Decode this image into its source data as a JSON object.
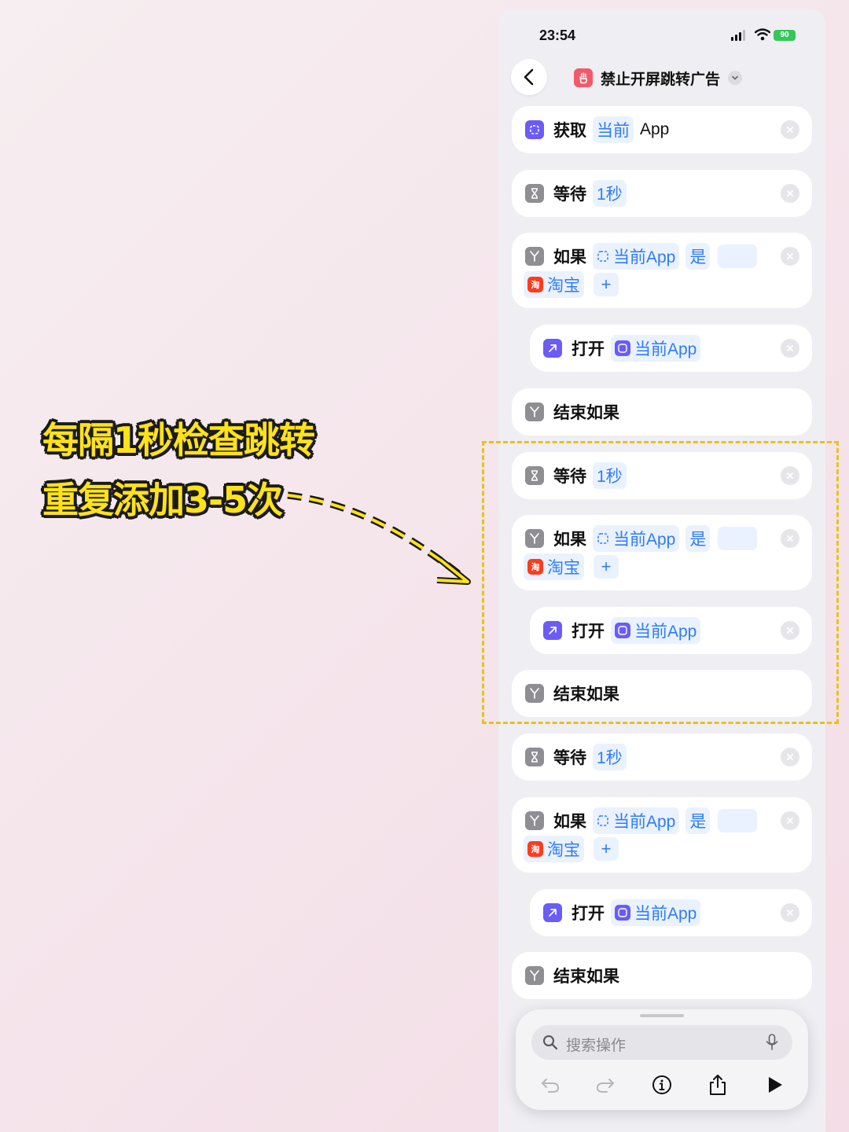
{
  "annotation": {
    "line1": "每隔1秒检查跳转",
    "line2": "重复添加3-5次"
  },
  "status_bar": {
    "time": "23:54",
    "battery": "90"
  },
  "header": {
    "title": "禁止开屏跳转广告"
  },
  "actions": {
    "get_app": {
      "verb": "获取",
      "token": "当前",
      "tail": "App"
    },
    "wait1": {
      "verb": "等待",
      "token": "1秒"
    },
    "if1": {
      "verb": "如果",
      "token": "当前App",
      "op": "是",
      "app": "淘宝"
    },
    "open1": {
      "verb": "打开",
      "token": "当前App"
    },
    "end1": {
      "verb": "结束如果"
    },
    "wait2": {
      "verb": "等待",
      "token": "1秒"
    },
    "if2": {
      "verb": "如果",
      "token": "当前App",
      "op": "是",
      "app": "淘宝"
    },
    "open2": {
      "verb": "打开",
      "token": "当前App"
    },
    "end2": {
      "verb": "结束如果"
    },
    "wait3": {
      "verb": "等待",
      "token": "1秒"
    },
    "if3": {
      "verb": "如果",
      "token": "当前App",
      "op": "是",
      "app": "淘宝"
    },
    "open3": {
      "verb": "打开",
      "token": "当前App"
    },
    "end3": {
      "verb": "结束如果"
    }
  },
  "taobao_icon_text": "淘",
  "plus": "+",
  "search": {
    "placeholder": "搜索操作"
  },
  "colors": {
    "accent": "#2f7cf6",
    "annotation_yellow": "#ffe21a",
    "icon_purple": "#6a5cf6",
    "icon_gray": "#8e8e93",
    "shortcut_icon": "#f05a6a"
  }
}
